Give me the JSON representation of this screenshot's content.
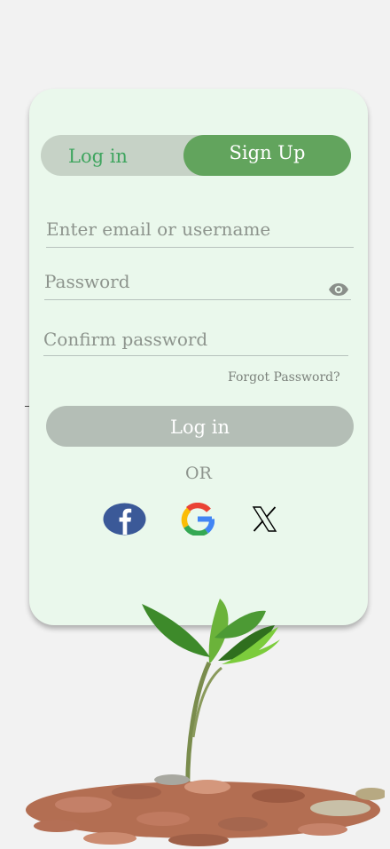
{
  "auth": {
    "tabs": {
      "login": "Log in",
      "signup": "Sign Up"
    },
    "fields": {
      "email_placeholder": "Enter email or username",
      "password_placeholder": "Password",
      "confirm_placeholder": "Confirm password"
    },
    "forgot_label": "Forgot Password?",
    "submit_label": "Log in",
    "divider_label": "OR",
    "social": [
      "facebook-icon",
      "google-icon",
      "x-icon"
    ]
  },
  "colors": {
    "accent": "#62a45d",
    "tab_text": "#3fa55f",
    "card_bg": "#eaf8ec",
    "button_disabled": "#b4beb6",
    "facebook": "#3b5998"
  }
}
